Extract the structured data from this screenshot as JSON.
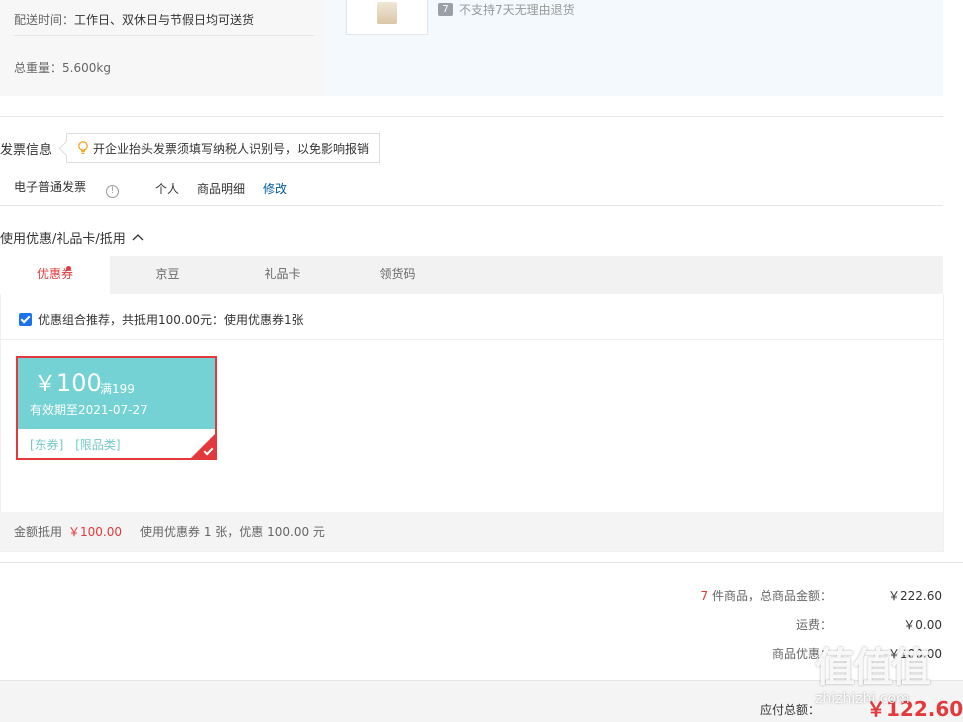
{
  "shipping": {
    "time_label": "配送时间：",
    "time_value": "工作日、双休日与节假日均可送货",
    "weight_label": "总重量：",
    "weight_value": "5.600kg",
    "no_return": "不支持7天无理由退货",
    "no_return_icon": "7"
  },
  "invoice": {
    "title": "发票信息",
    "tip": "开企业抬头发票须填写纳税人识别号，以免影响报销",
    "type": "电子普通发票",
    "info_icon": "!",
    "holder": "个人",
    "content": "商品明细",
    "edit": "修改"
  },
  "coupons": {
    "title": "使用优惠/礼品卡/抵用",
    "expand_icon": "chevron-up-icon",
    "tabs": [
      {
        "label": "优惠券"
      },
      {
        "label": "京豆"
      },
      {
        "label": "礼品卡"
      },
      {
        "label": "领货码"
      }
    ],
    "recommend": "优惠组合推荐，共抵用100.00元：使用优惠券1张",
    "coupon": {
      "currency": "￥",
      "amount": "100",
      "condition": "满199",
      "valid": "有效期至2021-07-27",
      "tag1": "[东券]",
      "tag2": "[限品类]"
    },
    "footer_label": "金额抵用",
    "footer_amount": "￥100.00",
    "footer_text": "使用优惠券 1 张，优惠 100.00 元"
  },
  "summary": {
    "count": "7",
    "items_label": "件商品，总商品金额：",
    "items_value": "￥222.60",
    "shipping_label": "运费：",
    "shipping_value": "￥0.00",
    "discount_label": "商品优惠：",
    "discount_value": "-￥100.00",
    "pay_label": "应付总额：",
    "pay_value": "￥122.60"
  },
  "watermark": {
    "logo": "值值值",
    "url": "zhizhizhi.com"
  },
  "colors": {
    "accent": "#e4393c",
    "coupon_bg": "#74d2d4",
    "link": "#005aa0"
  }
}
